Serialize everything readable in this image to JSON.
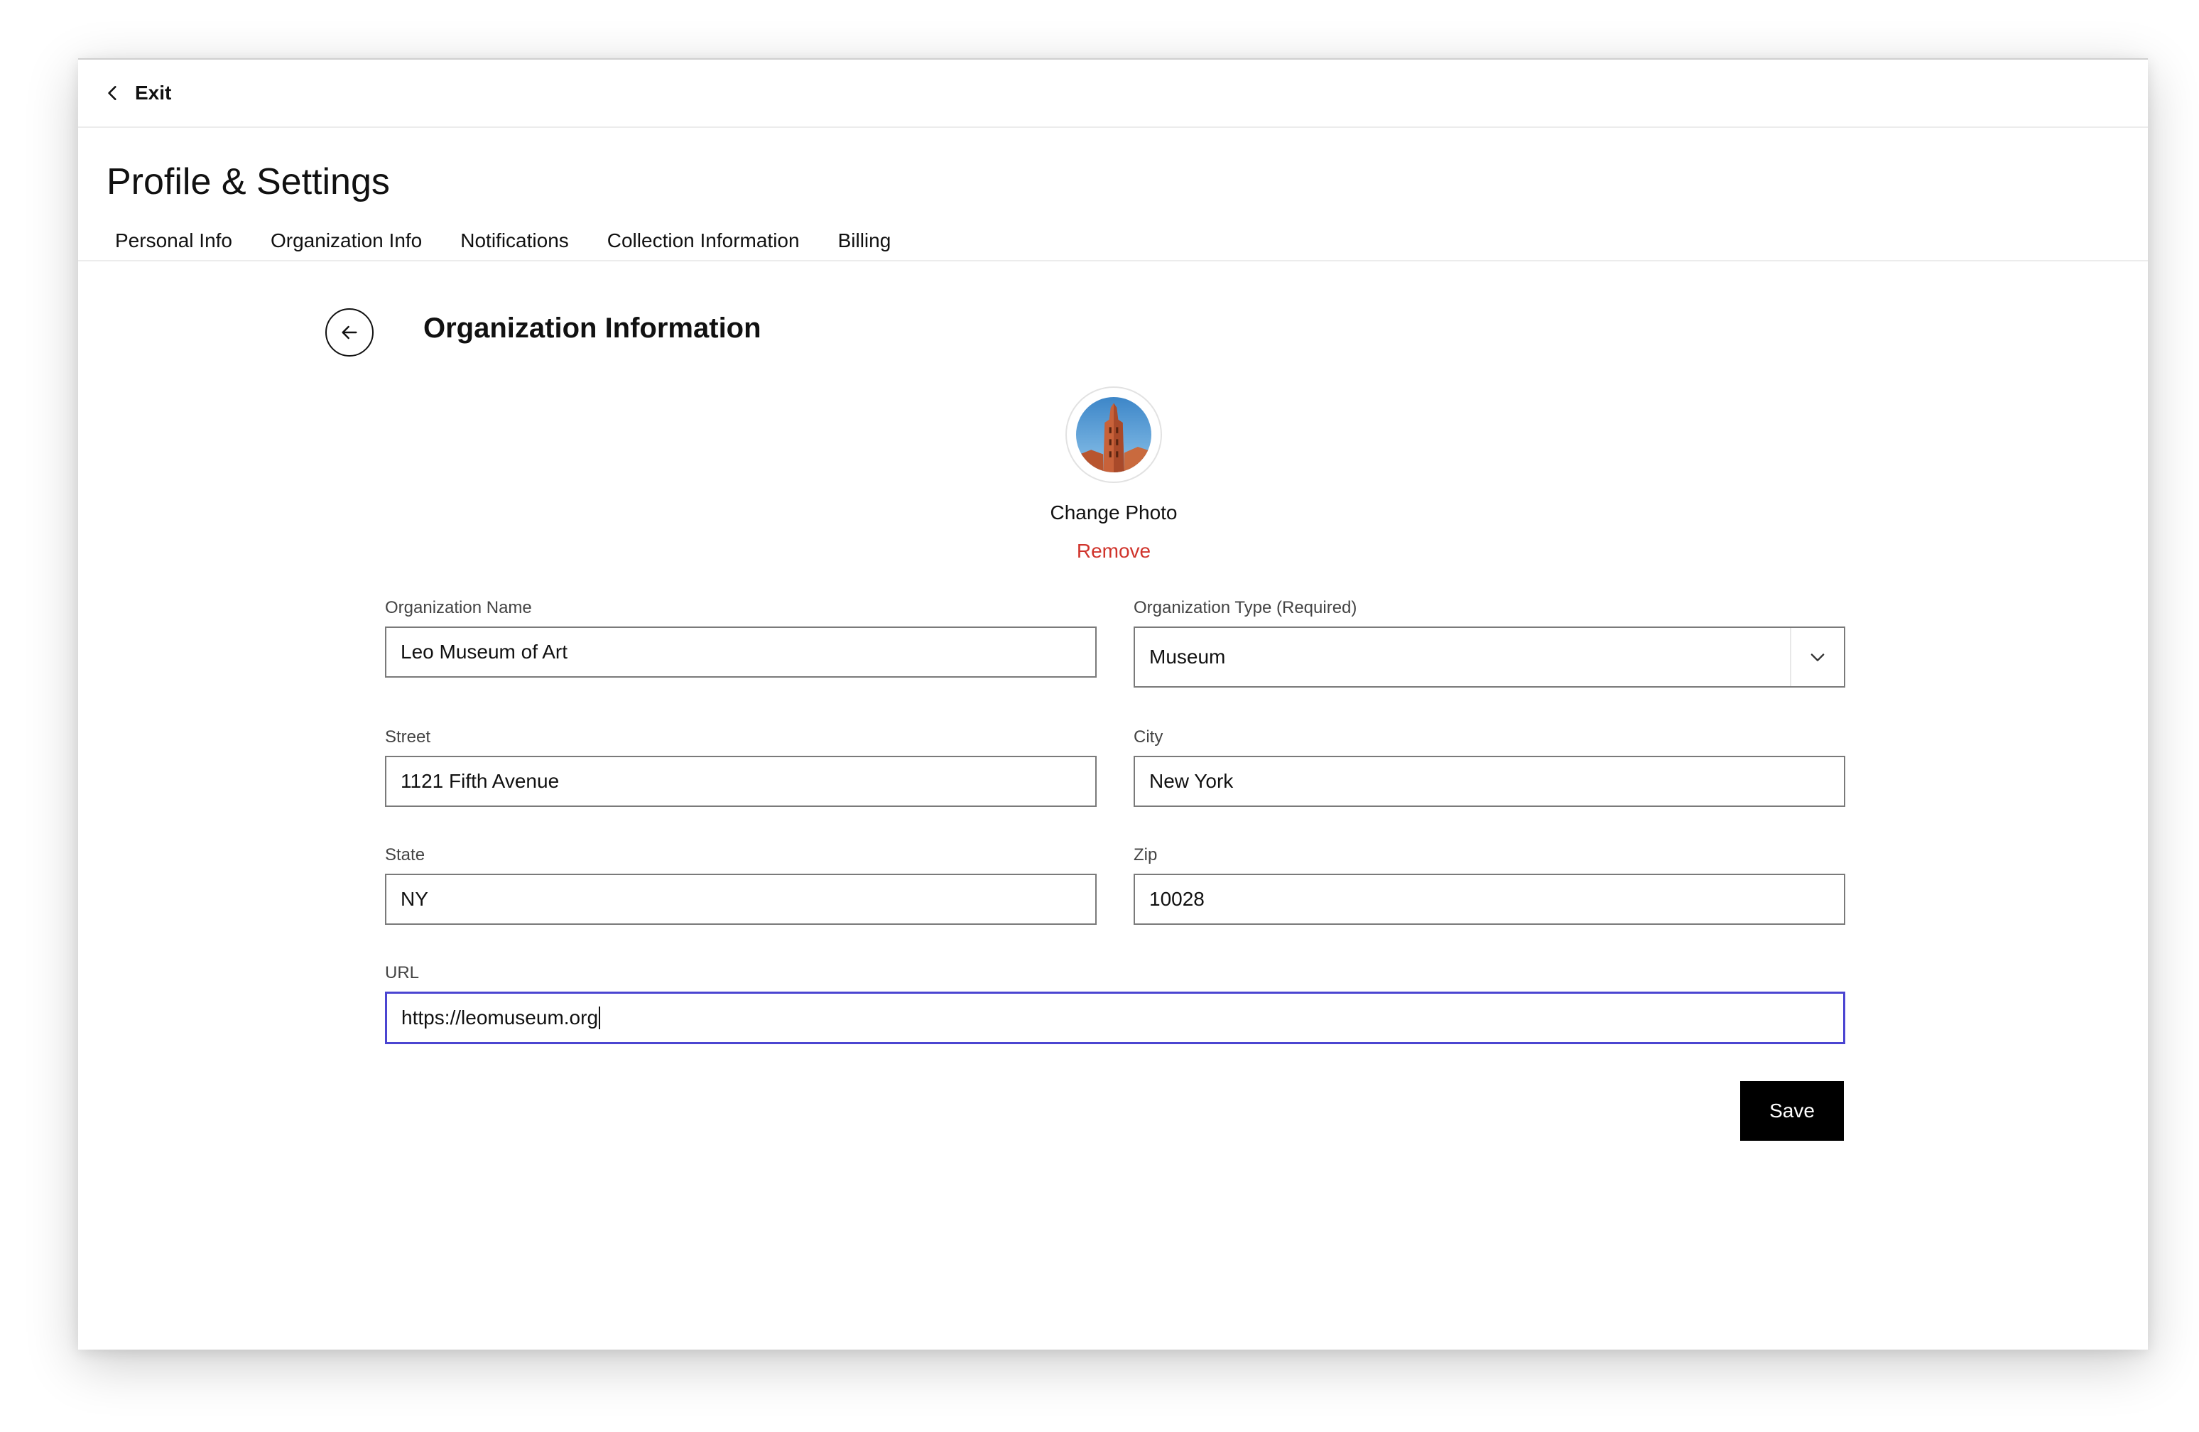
{
  "topbar": {
    "exit_label": "Exit"
  },
  "page_title": "Profile & Settings",
  "tabs": [
    {
      "label": "Personal Info"
    },
    {
      "label": "Organization Info"
    },
    {
      "label": "Notifications"
    },
    {
      "label": "Collection Information"
    },
    {
      "label": "Billing"
    }
  ],
  "section": {
    "title": "Organization Information"
  },
  "photo": {
    "change_label": "Change Photo",
    "remove_label": "Remove",
    "remove_color": "#d0342c"
  },
  "form": {
    "org_name": {
      "label": "Organization Name",
      "value": "Leo Museum of Art"
    },
    "org_type": {
      "label": "Organization Type (Required)",
      "value": "Museum"
    },
    "street": {
      "label": "Street",
      "value": "1121 Fifth Avenue"
    },
    "city": {
      "label": "City",
      "value": "New York"
    },
    "state": {
      "label": "State",
      "value": "NY"
    },
    "zip": {
      "label": "Zip",
      "value": "10028"
    },
    "url": {
      "label": "URL",
      "value": "https://leomuseum.org"
    }
  },
  "actions": {
    "save_label": "Save",
    "save_bg": "#000000"
  },
  "colors": {
    "focus": "#4b45d1",
    "field_border": "#7a7a7a"
  },
  "icons": {
    "exit": "chevron-left-icon",
    "back": "arrow-left-icon",
    "select": "chevron-down-icon"
  }
}
